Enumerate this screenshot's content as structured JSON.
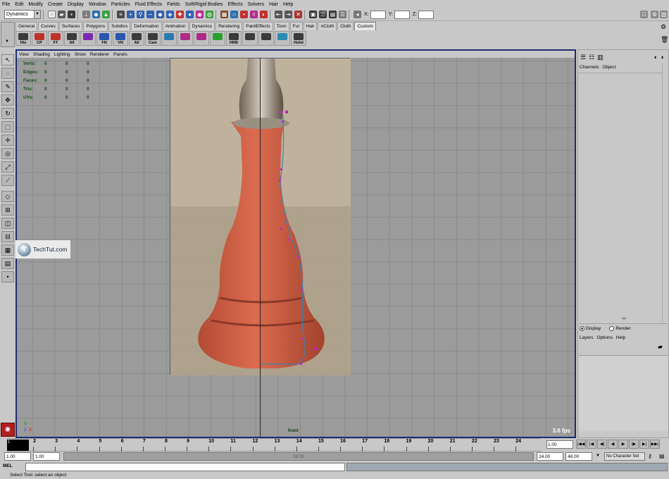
{
  "menubar": [
    "File",
    "Edit",
    "Modify",
    "Create",
    "Display",
    "Window",
    "Particles",
    "Fluid Effects",
    "Fields",
    "Soft/Rigid Bodies",
    "Effects",
    "Solvers",
    "Hair",
    "Help"
  ],
  "status_line": {
    "menuset": "Dynamics",
    "x_label": "X:",
    "y_label": "Y:",
    "z_label": "Z:"
  },
  "shelf_tabs": [
    {
      "label": "General",
      "active": false
    },
    {
      "label": "Curves",
      "active": false
    },
    {
      "label": "Surfaces",
      "active": false
    },
    {
      "label": "Polygons",
      "active": false
    },
    {
      "label": "Subdivs",
      "active": false
    },
    {
      "label": "Deformation",
      "active": false
    },
    {
      "label": "Animation",
      "active": false
    },
    {
      "label": "Dynamics",
      "active": false
    },
    {
      "label": "Rendering",
      "active": false
    },
    {
      "label": "PaintEffects",
      "active": false
    },
    {
      "label": "Toon",
      "active": false
    },
    {
      "label": "Fur",
      "active": false
    },
    {
      "label": "Hair",
      "active": false
    },
    {
      "label": "nCloth",
      "active": false
    },
    {
      "label": "Cloth",
      "active": false
    },
    {
      "label": "Custom",
      "active": true
    }
  ],
  "shelf_buttons": [
    {
      "label": "His",
      "color": "#3a3a3a"
    },
    {
      "label": "CP",
      "color": "#c0302a"
    },
    {
      "label": "FT",
      "color": "#c0302a"
    },
    {
      "label": "All",
      "color": "#3a3a3a"
    },
    {
      "label": "",
      "color": "#7b2ab0"
    },
    {
      "label": "FN",
      "color": "#2a55b0"
    },
    {
      "label": "VN",
      "color": "#2a55b0"
    },
    {
      "label": "All",
      "color": "#3a3a3a"
    },
    {
      "label": "Cam",
      "color": "#3a3a3a"
    },
    {
      "label": "",
      "color": "#2a7ab0"
    },
    {
      "label": "",
      "color": "#b02a8a"
    },
    {
      "label": "",
      "color": "#b02a8a"
    },
    {
      "label": "",
      "color": "#2aa030"
    },
    {
      "label": "HRB",
      "color": "#3a3a3a"
    },
    {
      "label": "",
      "color": "#3a3a3a"
    },
    {
      "label": "",
      "color": "#3a3a3a"
    },
    {
      "label": "",
      "color": "#2a8ab0"
    },
    {
      "label": "Hshd",
      "color": "#3a3a3a"
    }
  ],
  "panel_menu": [
    "View",
    "Shading",
    "Lighting",
    "Show",
    "Renderer",
    "Panels"
  ],
  "hud": {
    "rows": [
      {
        "label": "Verts:",
        "v": [
          "0",
          "0",
          "0"
        ]
      },
      {
        "label": "Edges:",
        "v": [
          "0",
          "0",
          "0"
        ]
      },
      {
        "label": "Faces:",
        "v": [
          "0",
          "0",
          "0"
        ]
      },
      {
        "label": "Tris:",
        "v": [
          "0",
          "0",
          "0"
        ]
      },
      {
        "label": "UVs:",
        "v": [
          "0",
          "0",
          "0"
        ]
      }
    ],
    "camera": "front",
    "fps": "3.6 fps"
  },
  "watermark": "TechTut.com",
  "channel_box": {
    "menu": [
      "Channels",
      "Object"
    ]
  },
  "layer_editor": {
    "display_label": "Display",
    "render_label": "Render",
    "menu": [
      "Layers",
      "Options",
      "Help"
    ]
  },
  "time_slider": {
    "current_frame": "1",
    "ticks": [
      "1",
      "2",
      "3",
      "4",
      "5",
      "6",
      "7",
      "8",
      "9",
      "10",
      "11",
      "12",
      "13",
      "14",
      "15",
      "16",
      "17",
      "18",
      "19",
      "20",
      "21",
      "22",
      "23",
      "24"
    ],
    "current_frame_field": "1.00"
  },
  "range_slider": {
    "start": "1.00",
    "playback_start": "1.00",
    "range_label": "24.00",
    "playback_end": "24.00",
    "end": "48.00",
    "character_set": "No Character Set"
  },
  "command_line": {
    "label": "MEL"
  },
  "help_line": "Select Tool: select an object"
}
